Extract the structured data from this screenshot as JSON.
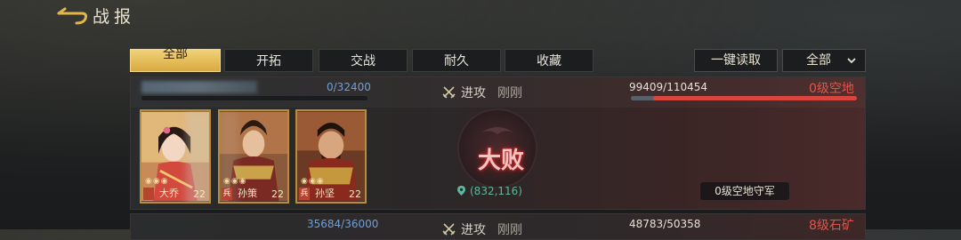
{
  "header": {
    "title": "战报"
  },
  "tabs": [
    {
      "label": "全部",
      "active": true
    },
    {
      "label": "开拓",
      "active": false
    },
    {
      "label": "交战",
      "active": false
    },
    {
      "label": "耐久",
      "active": false
    },
    {
      "label": "收藏",
      "active": false
    }
  ],
  "toolbar": {
    "read_all_label": "一键读取",
    "filter_value": "全部"
  },
  "report": {
    "attacker_troops": "0/32400",
    "attacker_troop_fraction": 0.0,
    "action": "进攻",
    "time": "刚刚",
    "defender_troops": "99409/110454",
    "defender_troop_fraction": 0.9,
    "target": "0级空地",
    "result": "大败",
    "coordinates": "(832,116)",
    "defender_name": "0级空地守军",
    "heroes": [
      {
        "name": "大乔",
        "level": "22",
        "badge": ""
      },
      {
        "name": "孙策",
        "level": "22",
        "badge": ""
      },
      {
        "name": "孙坚",
        "level": "22",
        "badge": ""
      }
    ]
  },
  "next_report": {
    "attacker_troops": "35684/36000",
    "action": "进攻",
    "time": "刚刚",
    "defender_troops": "48783/50358",
    "target": "8级石矿"
  },
  "colors": {
    "accent_gold": "#d9a93f",
    "loss_red": "#e0554a",
    "troop_blue": "#2d5da8",
    "coord_green": "#59b89d"
  }
}
